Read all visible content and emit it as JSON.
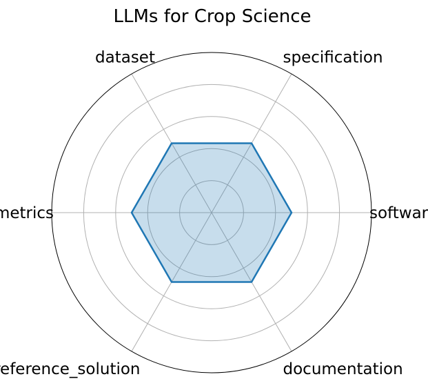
{
  "chart_data": {
    "type": "radar",
    "title": "LLMs for Crop Science",
    "axes": [
      "software",
      "specification",
      "dataset",
      "metrics",
      "reference_solution",
      "documentation"
    ],
    "series": [
      {
        "values": [
          0.5,
          0.5,
          0.5,
          0.5,
          0.5,
          0.5
        ],
        "color": "#1f77b4",
        "fill_color": "#1f77b4",
        "fill_opacity": 0.25
      }
    ],
    "rlim": [
      0,
      1
    ],
    "radial_ticks": [
      0.2,
      0.4,
      0.6,
      0.8
    ],
    "radial_tick_labels_shown": false,
    "grid": true
  }
}
